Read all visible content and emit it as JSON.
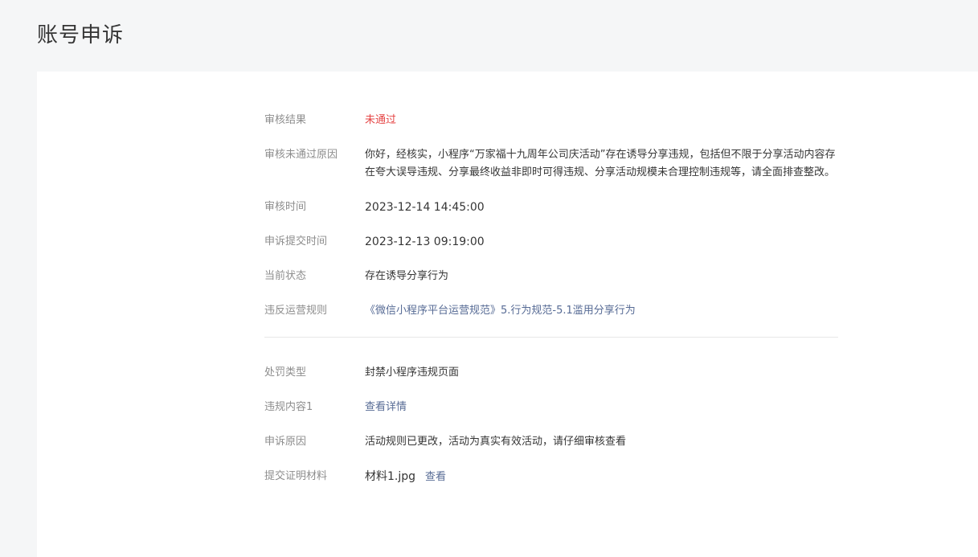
{
  "page": {
    "title": "账号申诉"
  },
  "section1": {
    "result": {
      "label": "审核结果",
      "value": "未通过"
    },
    "reason": {
      "label": "审核未通过原因",
      "value": "你好，经核实，小程序“万家福十九周年公司庆活动”存在诱导分享违规，包括但不限于分享活动内容存在夸大误导违规、分享最终收益非即时可得违规、分享活动规模未合理控制违规等，请全面排查整改。"
    },
    "review_time": {
      "label": "审核时间",
      "value": "2023-12-14 14:45:00"
    },
    "submit_time": {
      "label": "申诉提交时间",
      "value": "2023-12-13 09:19:00"
    },
    "status": {
      "label": "当前状态",
      "value": "存在诱导分享行为"
    },
    "rule": {
      "label": "违反运营规则",
      "value": "《微信小程序平台运营规范》5.行为规范-5.1滥用分享行为"
    }
  },
  "section2": {
    "penalty": {
      "label": "处罚类型",
      "value": "封禁小程序违规页面"
    },
    "violation": {
      "label": "违规内容1",
      "value": "查看详情"
    },
    "appeal_reason": {
      "label": "申诉原因",
      "value": "活动规则已更改，活动为真实有效活动，请仔细审核查看"
    },
    "material": {
      "label": "提交证明材料",
      "file": "材料1.jpg",
      "view": "查看"
    }
  },
  "colors": {
    "danger": "#e54545",
    "link": "#576b95",
    "label": "#8d8d8d",
    "text": "#353535",
    "background": "#f5f6f7"
  }
}
